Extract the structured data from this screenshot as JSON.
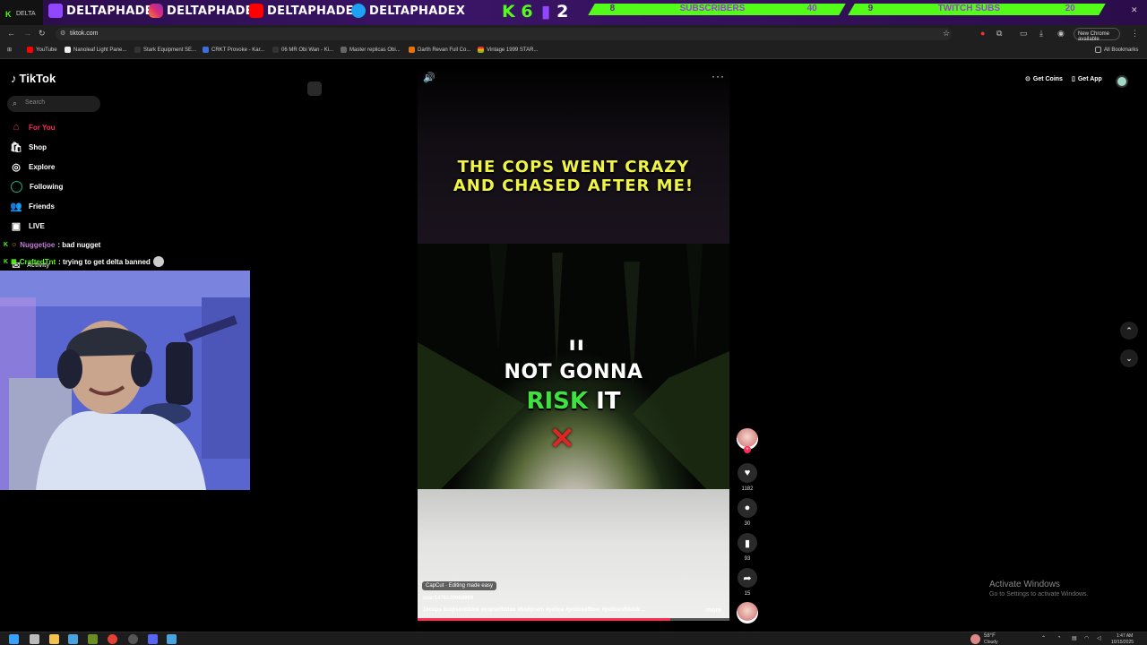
{
  "banner": {
    "tab_label": "DELTA",
    "handles": [
      "DELTAPHADE",
      "DELTAPHADE",
      "DELTAPHADE",
      "DELTAPHADEX"
    ],
    "kick_count": "6",
    "twitch_count": "2",
    "subscribers_label": "SUBSCRIBERS",
    "subscribers_current": "8",
    "subscribers_goal": "40",
    "twitch_subs_label": "TWITCH SUBS",
    "twitch_subs_current": "9",
    "twitch_subs_goal": "20",
    "colors": {
      "kick": "#53fc18",
      "twitch": "#9146ff",
      "purple_bg": "#2b0d4a"
    }
  },
  "browser": {
    "url": "tiktok.com",
    "new_chrome_label": "New Chrome available",
    "bookmarks": [
      "YouTube",
      "Nanoleaf Light Pane...",
      "Stark Equipment SE...",
      "CRKT Provoke - Kar...",
      "06 MR Obi Wan - Ki...",
      "Master replicas Obi...",
      "Darth Revan Full Co...",
      "Vintage 1999 STAR..."
    ],
    "all_bookmarks_label": "All Bookmarks"
  },
  "tiktok": {
    "logo_text": "TikTok",
    "search_placeholder": "Search",
    "nav": [
      {
        "label": "For You",
        "icon": "home-icon",
        "active": true
      },
      {
        "label": "Shop",
        "icon": "shop-icon"
      },
      {
        "label": "Explore",
        "icon": "explore-icon"
      },
      {
        "label": "Following",
        "icon": "following-icon"
      },
      {
        "label": "Friends",
        "icon": "friends-icon"
      },
      {
        "label": "LIVE",
        "icon": "live-icon"
      },
      {
        "label": "Activity",
        "icon": "activity-icon"
      }
    ],
    "get_coins_label": "Get Coins",
    "get_app_label": "Get App"
  },
  "chat": [
    {
      "user": "Nuggetjoe",
      "message": ": bad nugget",
      "user_color": "#c07ad6"
    },
    {
      "user": "CraftedTnt",
      "message": ": trying to get delta banned",
      "user_color": "#53fc18"
    }
  ],
  "video": {
    "caption_top_line1": "THE COPS WENT CRAZY",
    "caption_top_line2": "AND CHASED AFTER ME!",
    "caption_mid_line1": "NOT GONNA",
    "caption_mid_word_green": "RISK",
    "caption_mid_word_white": "IT",
    "x_symbol": "✕",
    "capcut_label": "CapCut · Editing made easy",
    "username": "user1476130668669",
    "hashtags": "1#cops #copsontiktok #copsoftiktok #bodycam #police #policeofficer #policeoftiktok ...",
    "more_label": "more",
    "progress": 0.81
  },
  "actions": {
    "likes": "1182",
    "comments": "30",
    "saves": "93",
    "shares": "15"
  },
  "watermark": {
    "line1": "Activate Windows",
    "line2": "Go to Settings to activate Windows."
  },
  "taskbar": {
    "weather_temp": "58°F",
    "weather_desc": "Cloudy",
    "time": "1:47 AM",
    "date": "10/15/2025"
  }
}
